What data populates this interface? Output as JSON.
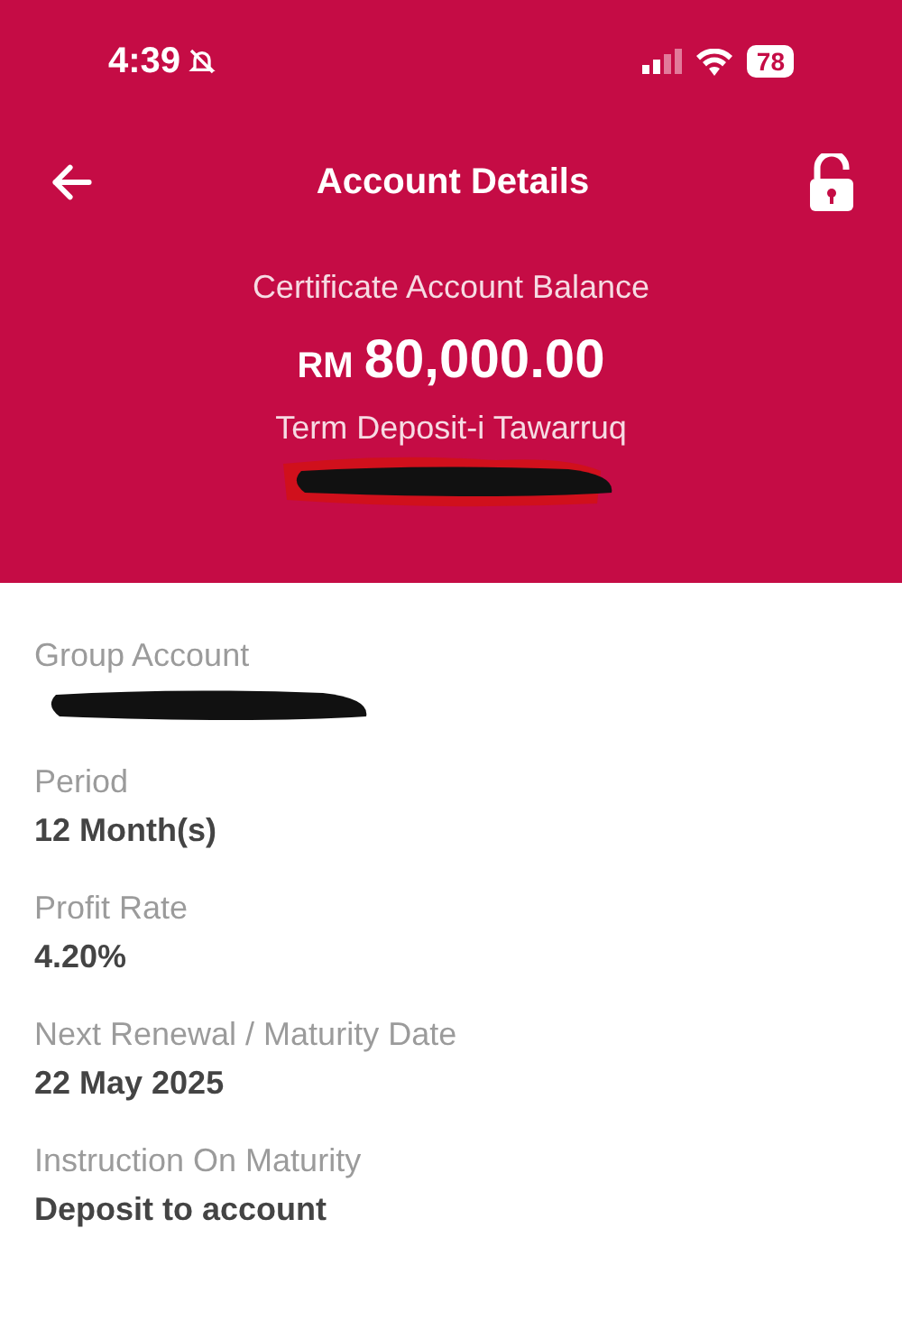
{
  "status_bar": {
    "time": "4:39",
    "battery": "78"
  },
  "header": {
    "title": "Account Details"
  },
  "balance": {
    "label": "Certificate Account Balance",
    "currency": "RM",
    "amount": "80,000.00",
    "product": "Term Deposit-i Tawarruq",
    "number_redacted": true
  },
  "fields": [
    {
      "label": "Group Account",
      "kind": "redacted"
    },
    {
      "label": "Period",
      "kind": "text",
      "value": "12 Month(s)"
    },
    {
      "label": "Profit Rate",
      "kind": "text",
      "value": "4.20%"
    },
    {
      "label": "Next Renewal / Maturity Date",
      "kind": "text",
      "value": "22 May 2025"
    },
    {
      "label": "Instruction On Maturity",
      "kind": "text",
      "value": "Deposit to account"
    }
  ]
}
